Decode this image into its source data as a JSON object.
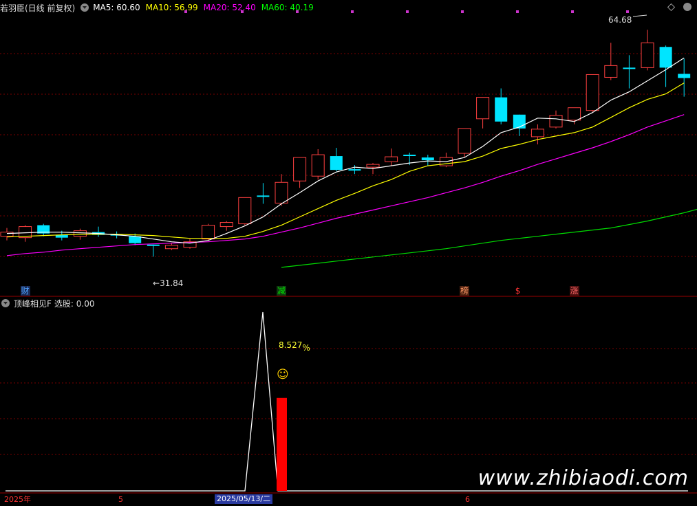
{
  "header": {
    "stock": "若羽臣(日线 前复权)",
    "ma": [
      {
        "label": "MA5: 60.60",
        "color": "#ffffff"
      },
      {
        "label": "MA10: 56.99",
        "color": "#ffff00"
      },
      {
        "label": "MA20: 52.40",
        "color": "#ff00ff"
      },
      {
        "label": "MA60: 40.19",
        "color": "#00ff00"
      }
    ]
  },
  "price_labels": {
    "high": "64.68",
    "low": "31.84"
  },
  "event_markers": [
    {
      "text": "财",
      "color": "#4fa3ff",
      "bg": "#1a2a55",
      "candle": 1
    },
    {
      "text": "减",
      "color": "#00dd00",
      "bg": "#103a10",
      "candle": 15
    },
    {
      "text": "榜",
      "color": "#ff9966",
      "bg": "#4a2010",
      "candle": 25
    },
    {
      "text": "$",
      "color": "#ff3333",
      "bg": "#000000",
      "candle": 28
    },
    {
      "text": "涨",
      "color": "#ff6666",
      "bg": "#4a1010",
      "candle": 31
    }
  ],
  "indicator": {
    "title": "顶峰相见F",
    "value_label": "选股: 0.00",
    "pct_label": "8.527",
    "pct_unit": "%",
    "smiley": "☺"
  },
  "axis": {
    "labels": [
      "2025年",
      "5",
      "2025/05/13/二",
      "6"
    ]
  },
  "watermark": "www.zhibiaodi.com",
  "chart_data": {
    "type": "candlestick",
    "candles": [
      {
        "o": 34.8,
        "c": 35.4,
        "h": 36.0,
        "l": 34.2
      },
      {
        "o": 34.6,
        "c": 36.2,
        "h": 36.4,
        "l": 34.0
      },
      {
        "o": 36.4,
        "c": 35.2,
        "h": 36.6,
        "l": 34.8
      },
      {
        "o": 35.0,
        "c": 34.6,
        "h": 35.6,
        "l": 34.2
      },
      {
        "o": 34.8,
        "c": 35.6,
        "h": 35.9,
        "l": 34.3
      },
      {
        "o": 35.4,
        "c": 35.0,
        "h": 36.2,
        "l": 34.7
      },
      {
        "o": 35.0,
        "c": 34.9,
        "h": 35.5,
        "l": 34.5
      },
      {
        "o": 34.8,
        "c": 33.8,
        "h": 35.2,
        "l": 33.5
      },
      {
        "o": 33.5,
        "c": 33.5,
        "h": 33.6,
        "l": 31.84
      },
      {
        "o": 33.0,
        "c": 33.5,
        "h": 33.8,
        "l": 32.8
      },
      {
        "o": 33.2,
        "c": 34.0,
        "h": 34.4,
        "l": 33.0
      },
      {
        "o": 34.4,
        "c": 36.4,
        "h": 36.6,
        "l": 34.2
      },
      {
        "o": 36.2,
        "c": 36.8,
        "h": 37.0,
        "l": 35.6
      },
      {
        "o": 36.6,
        "c": 40.4,
        "h": 40.4,
        "l": 36.4
      },
      {
        "o": 40.6,
        "c": 40.6,
        "h": 42.5,
        "l": 39.5
      },
      {
        "o": 39.6,
        "c": 42.6,
        "h": 43.8,
        "l": 39.2
      },
      {
        "o": 42.8,
        "c": 46.2,
        "h": 46.2,
        "l": 41.8
      },
      {
        "o": 43.5,
        "c": 46.6,
        "h": 47.4,
        "l": 43.0
      },
      {
        "o": 46.4,
        "c": 44.4,
        "h": 47.6,
        "l": 44.2
      },
      {
        "o": 44.4,
        "c": 44.4,
        "h": 45.1,
        "l": 43.8
      },
      {
        "o": 44.8,
        "c": 45.2,
        "h": 45.4,
        "l": 43.8
      },
      {
        "o": 45.6,
        "c": 46.3,
        "h": 47.5,
        "l": 45.0
      },
      {
        "o": 46.5,
        "c": 46.5,
        "h": 46.9,
        "l": 45.1
      },
      {
        "o": 46.2,
        "c": 45.8,
        "h": 46.6,
        "l": 45.0
      },
      {
        "o": 45.0,
        "c": 46.2,
        "h": 46.9,
        "l": 44.8
      },
      {
        "o": 46.8,
        "c": 50.4,
        "h": 50.4,
        "l": 46.2
      },
      {
        "o": 51.8,
        "c": 54.9,
        "h": 54.9,
        "l": 50.4
      },
      {
        "o": 54.9,
        "c": 51.4,
        "h": 56.2,
        "l": 51.0
      },
      {
        "o": 52.4,
        "c": 50.4,
        "h": 52.4,
        "l": 49.3
      },
      {
        "o": 49.2,
        "c": 50.3,
        "h": 51.0,
        "l": 48.1
      },
      {
        "o": 50.6,
        "c": 52.3,
        "h": 53.0,
        "l": 50.4
      },
      {
        "o": 51.6,
        "c": 53.4,
        "h": 53.4,
        "l": 51.0
      },
      {
        "o": 53.0,
        "c": 58.2,
        "h": 58.2,
        "l": 52.8
      },
      {
        "o": 57.8,
        "c": 59.5,
        "h": 62.8,
        "l": 57.4
      },
      {
        "o": 59.1,
        "c": 59.1,
        "h": 61.0,
        "l": 56.2
      },
      {
        "o": 59.2,
        "c": 62.8,
        "h": 64.68,
        "l": 58.8
      },
      {
        "o": 62.2,
        "c": 59.2,
        "h": 62.4,
        "l": 56.4
      },
      {
        "o": 58.3,
        "c": 57.7,
        "h": 60.5,
        "l": 55.0
      }
    ],
    "ma5": [
      35.2,
      35.3,
      35.4,
      35.4,
      35.3,
      35.2,
      35.0,
      34.8,
      34.4,
      34.0,
      33.8,
      34.2,
      35.2,
      36.3,
      37.6,
      39.5,
      41.1,
      42.8,
      44.1,
      44.8,
      44.6,
      45.0,
      45.4,
      45.7,
      45.6,
      46.2,
      47.8,
      49.8,
      50.6,
      51.9,
      51.8,
      51.4,
      52.7,
      54.5,
      55.7,
      57.3,
      58.9,
      60.6
    ],
    "ma10": [
      34.7,
      34.8,
      34.9,
      35.0,
      35.1,
      35.1,
      35.1,
      35.0,
      34.9,
      34.7,
      34.5,
      34.5,
      34.5,
      34.8,
      35.5,
      36.4,
      37.6,
      38.8,
      40.0,
      41.0,
      42.1,
      43.0,
      44.2,
      45.0,
      45.3,
      45.6,
      46.4,
      47.5,
      48.1,
      48.8,
      49.3,
      49.8,
      50.6,
      52.0,
      53.4,
      54.6,
      55.4,
      56.99
    ],
    "ma20": [
      32.0,
      32.3,
      32.5,
      32.8,
      33.0,
      33.2,
      33.4,
      33.6,
      33.7,
      33.8,
      33.9,
      34.0,
      34.2,
      34.4,
      34.8,
      35.4,
      36.0,
      36.7,
      37.4,
      38.0,
      38.6,
      39.2,
      39.8,
      40.4,
      41.1,
      41.8,
      42.6,
      43.5,
      44.3,
      45.2,
      46.0,
      46.8,
      47.6,
      48.5,
      49.5,
      50.6,
      51.5,
      52.4
    ],
    "ma60_start": 15,
    "ma60": [
      30.3,
      30.6,
      30.9,
      31.2,
      31.5,
      31.8,
      32.1,
      32.4,
      32.7,
      33.0,
      33.4,
      33.8,
      34.2,
      34.5,
      34.8,
      35.1,
      35.4,
      35.7,
      36.0,
      36.5,
      37.0,
      37.6,
      38.2,
      38.9,
      39.6,
      40.19
    ],
    "indicator_line": {
      "x_candles": [
        0,
        13,
        14,
        15,
        38
      ],
      "values": [
        0,
        0,
        1,
        0,
        0
      ]
    },
    "indicator_bar": {
      "candle": 15,
      "value": 0.52
    }
  }
}
